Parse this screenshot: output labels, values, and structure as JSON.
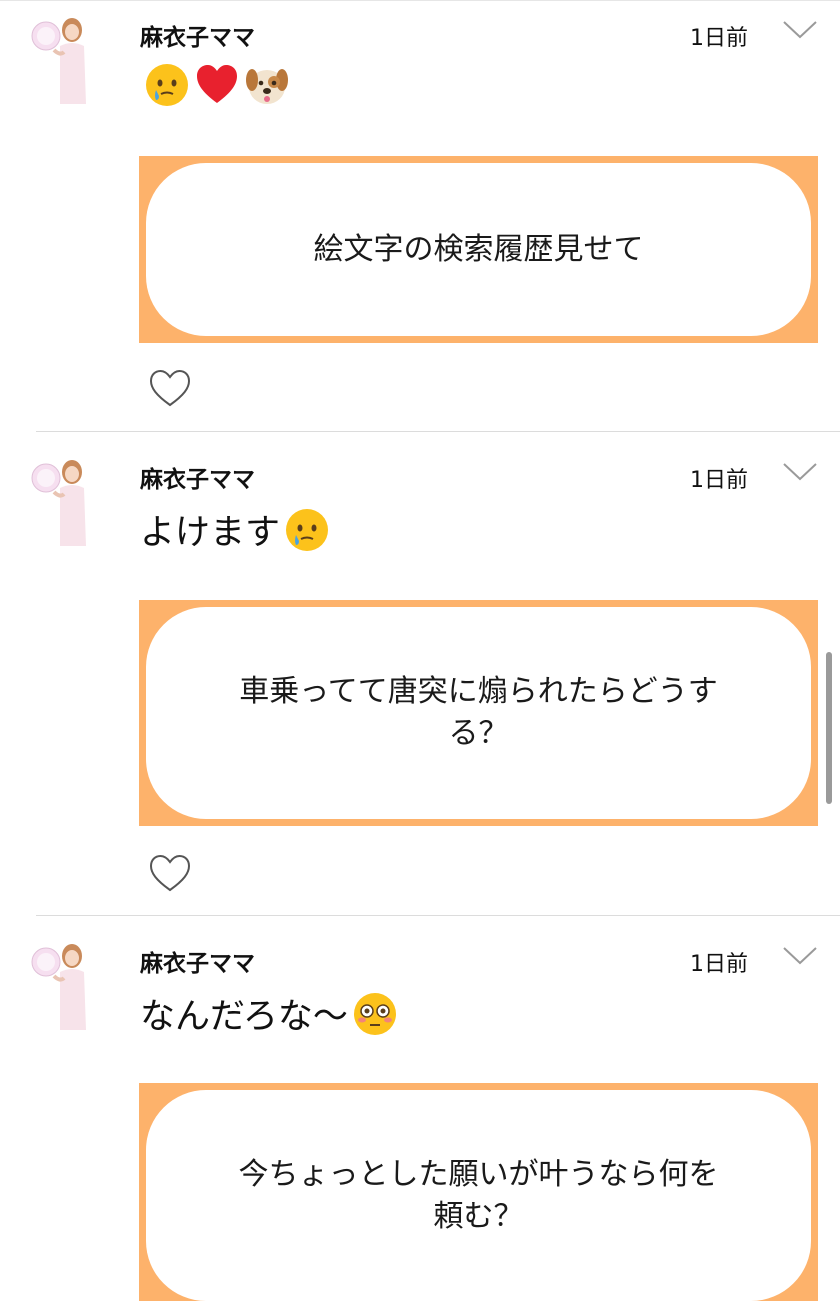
{
  "posts": [
    {
      "username": "麻衣子ママ",
      "time": "1日前",
      "text": "",
      "emojis": [
        "face-holding-back-tears",
        "red-heart",
        "dog-face"
      ],
      "card_text": "絵文字の検索履歴見せて"
    },
    {
      "username": "麻衣子ママ",
      "time": "1日前",
      "text": "よけます",
      "emojis": [
        "face-holding-back-tears"
      ],
      "card_text": "車乗ってて唐突に煽られたらどうする？"
    },
    {
      "username": "麻衣子ママ",
      "time": "1日前",
      "text": "なんだろな〜",
      "emojis": [
        "flushed-face"
      ],
      "card_text": "今ちょっとした願いが叶うなら何を頼む？"
    }
  ],
  "colors": {
    "card_border": "#fdb26b",
    "divider": "#dcdcdc",
    "scrollbar": "#9a9a9a"
  }
}
